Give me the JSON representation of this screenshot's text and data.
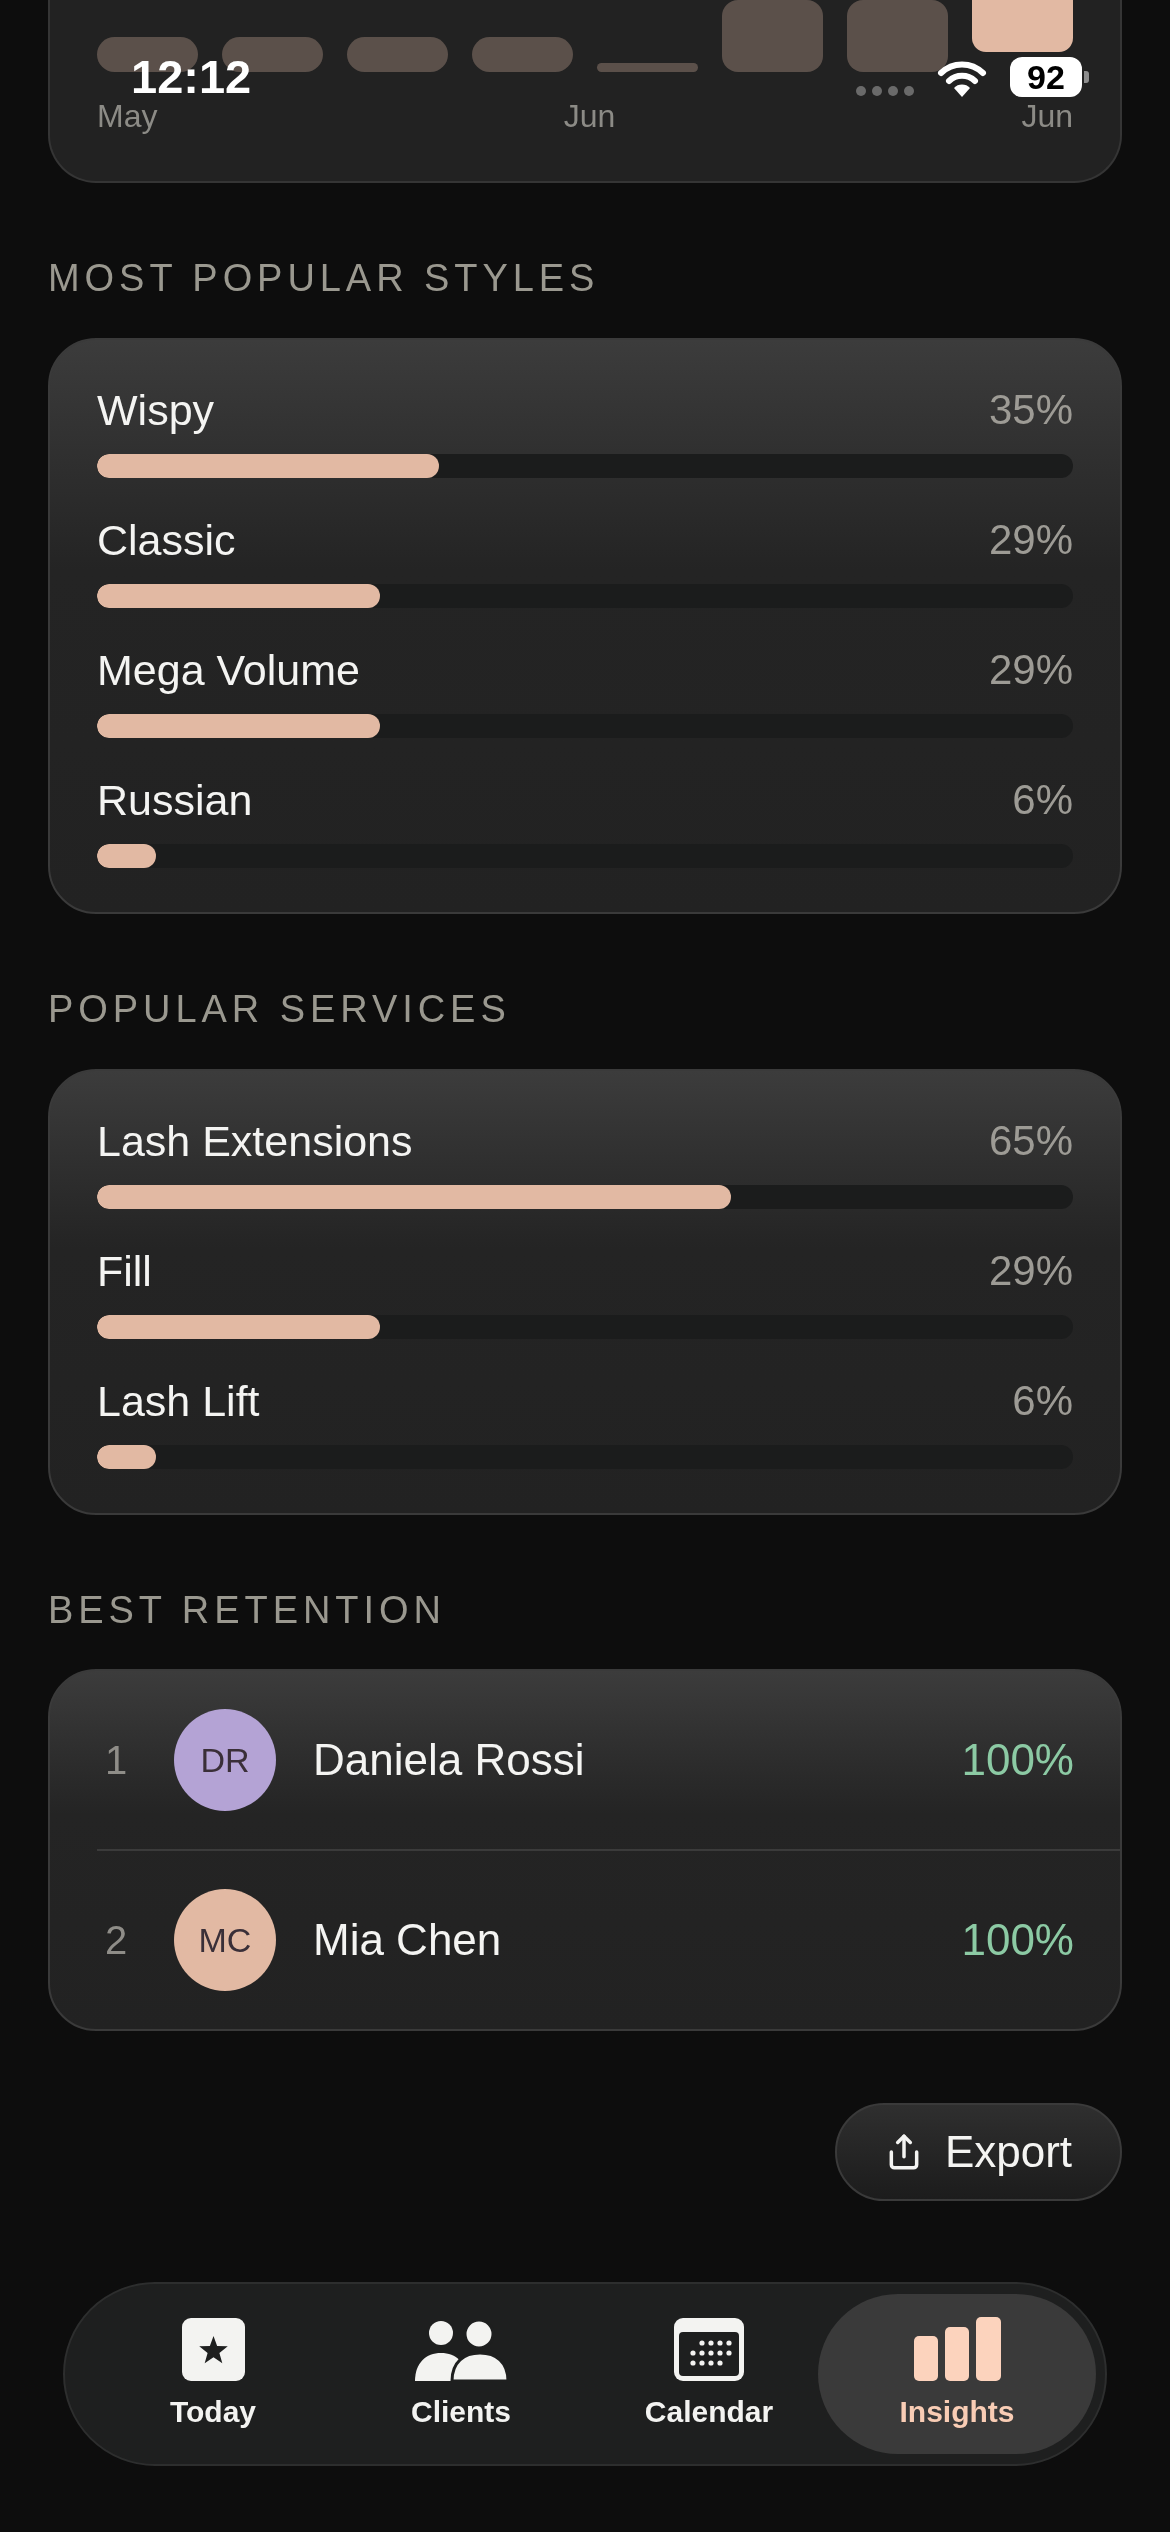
{
  "status_bar": {
    "time": "12:12",
    "battery": "92"
  },
  "activity_chart": {
    "bars": [
      {
        "selected": false
      },
      {
        "selected": false
      },
      {
        "selected": false
      },
      {
        "selected": false
      },
      {
        "selected": false
      },
      {
        "selected": false
      },
      {
        "selected": false
      },
      {
        "selected": true
      }
    ],
    "x_labels": [
      "May",
      "Jun",
      "Jun"
    ]
  },
  "styles": {
    "heading": "MOST POPULAR STYLES",
    "items": [
      {
        "label": "Wispy",
        "value": "35%",
        "level": 0.35
      },
      {
        "label": "Classic",
        "value": "29%",
        "level": 0.29
      },
      {
        "label": "Mega Volume",
        "value": "29%",
        "level": 0.29
      },
      {
        "label": "Russian",
        "value": "6%",
        "level": 0.06
      }
    ]
  },
  "services": {
    "heading": "POPULAR SERVICES",
    "items": [
      {
        "label": "Lash Extensions",
        "value": "65%",
        "level": 0.65
      },
      {
        "label": "Fill",
        "value": "29%",
        "level": 0.29
      },
      {
        "label": "Lash Lift",
        "value": "6%",
        "level": 0.06
      }
    ]
  },
  "retention": {
    "heading": "BEST RETENTION",
    "rows": [
      {
        "rank": "1",
        "initials": "DR",
        "name": "Daniela Rossi",
        "value": "100%",
        "color": "#b4a3d5"
      },
      {
        "rank": "2",
        "initials": "MC",
        "name": "Mia Chen",
        "value": "100%",
        "color": "#e2b9a3"
      }
    ]
  },
  "export_button": {
    "label": "Export"
  },
  "tab_bar": {
    "tabs": [
      {
        "label": "Today",
        "selected": false
      },
      {
        "label": "Clients",
        "selected": false
      },
      {
        "label": "Calendar",
        "selected": false
      },
      {
        "label": "Insights",
        "selected": true
      }
    ]
  }
}
